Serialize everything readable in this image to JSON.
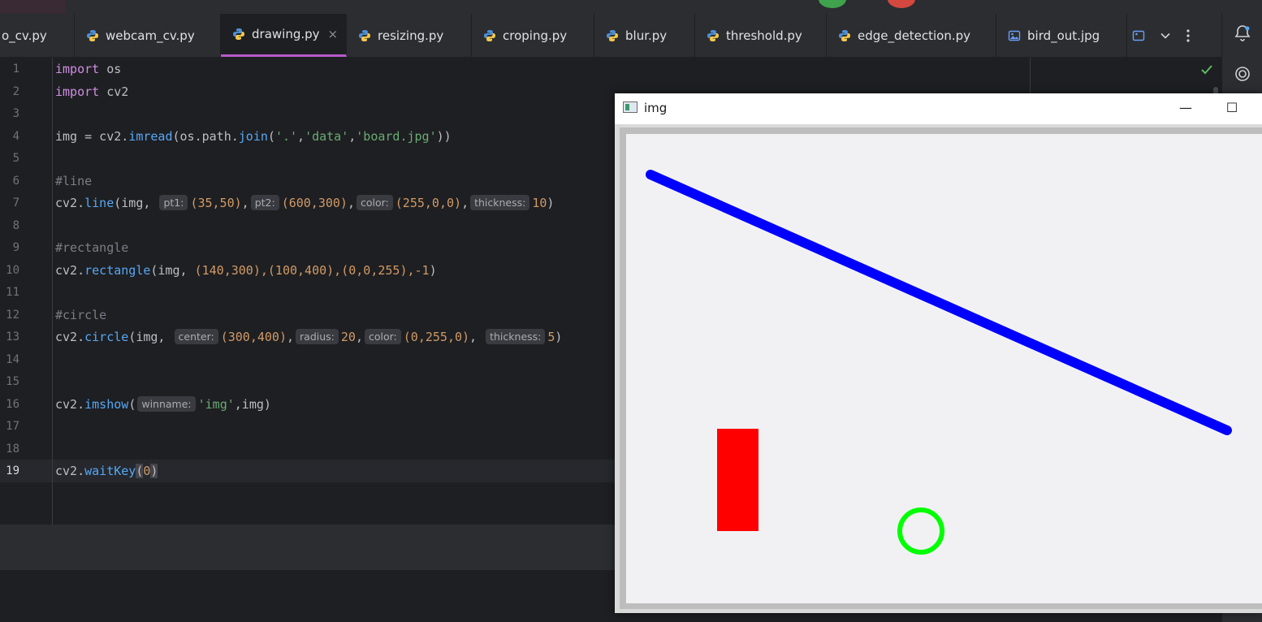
{
  "tabs": [
    {
      "label": "o_cv.py",
      "active": false,
      "icon": "python-icon"
    },
    {
      "label": "webcam_cv.py",
      "active": false,
      "icon": "python-icon"
    },
    {
      "label": "drawing.py",
      "active": true,
      "icon": "python-icon"
    },
    {
      "label": "resizing.py",
      "active": false,
      "icon": "python-icon"
    },
    {
      "label": "croping.py",
      "active": false,
      "icon": "python-icon"
    },
    {
      "label": "blur.py",
      "active": false,
      "icon": "python-icon"
    },
    {
      "label": "threshold.py",
      "active": false,
      "icon": "python-icon"
    },
    {
      "label": "edge_detection.py",
      "active": false,
      "icon": "python-icon"
    },
    {
      "label": "bird_out.jpg",
      "active": false,
      "icon": "image-file-icon"
    }
  ],
  "tab_close_glyph": "×",
  "editor": {
    "line_numbers": [
      "1",
      "2",
      "3",
      "4",
      "5",
      "6",
      "7",
      "8",
      "9",
      "10",
      "11",
      "12",
      "13",
      "14",
      "15",
      "16",
      "17",
      "18",
      "19"
    ],
    "current_line": "19",
    "code": {
      "l1_kw": "import",
      "l1_mod": " os",
      "l2_kw": "import",
      "l2_mod": " cv2",
      "l4_a": "img = cv2.",
      "l4_fn": "imread",
      "l4_b": "(os.path.",
      "l4_fn2": "join",
      "l4_c": "(",
      "l4_s1": "'.'",
      "l4_d": ",",
      "l4_s2": "'data'",
      "l4_e": ",",
      "l4_s3": "'board.jpg'",
      "l4_f": "))",
      "l6": "#line",
      "l7_a": "cv2.",
      "l7_fn": "line",
      "l7_b": "(img, ",
      "l7_h1": "pt1:",
      "l7_t1": "(35,50)",
      "l7_c1": ",",
      "l7_h2": "pt2:",
      "l7_t2": "(600,300)",
      "l7_c2": ",",
      "l7_h3": "color:",
      "l7_t3": "(255,0,0)",
      "l7_c3": ",",
      "l7_h4": "thickness:",
      "l7_t4": "10",
      "l7_end": ")",
      "l9": "#rectangle",
      "l10_a": "cv2.",
      "l10_fn": "rectangle",
      "l10_b": "(img, ",
      "l10_t": "(140,300),(100,400),(0,0,255),-1",
      "l10_end": ")",
      "l12": "#circle",
      "l13_a": "cv2.",
      "l13_fn": "circle",
      "l13_b": "(img, ",
      "l13_h1": "center:",
      "l13_t1": "(300,400)",
      "l13_c1": ",",
      "l13_h2": "radius:",
      "l13_t2": "20",
      "l13_c2": ",",
      "l13_h3": "color:",
      "l13_t3": "(0,255,0)",
      "l13_c3": ", ",
      "l13_h4": "thickness:",
      "l13_t4": "5",
      "l13_end": ")",
      "l16_a": "cv2.",
      "l16_fn": "imshow",
      "l16_b": "(",
      "l16_h1": "winname:",
      "l16_s": "'img'",
      "l16_end": ",img)",
      "l19_a": "cv2.",
      "l19_fn": "waitKey",
      "l19_b": "(",
      "l19_n": "0",
      "l19_end": ")"
    }
  },
  "image_window": {
    "title": "img",
    "minimize_glyph": "—",
    "maximize_glyph": "☐",
    "colors": {
      "line": "#0000ff",
      "rectangle": "#ff0000",
      "circle": "#00ff00",
      "board": "#f1f1f4"
    }
  },
  "icons": [
    "python-icon",
    "image-file-icon",
    "chevron-down-icon",
    "more-vert-icon",
    "bell-icon",
    "ai-assistant-icon",
    "check-icon"
  ]
}
